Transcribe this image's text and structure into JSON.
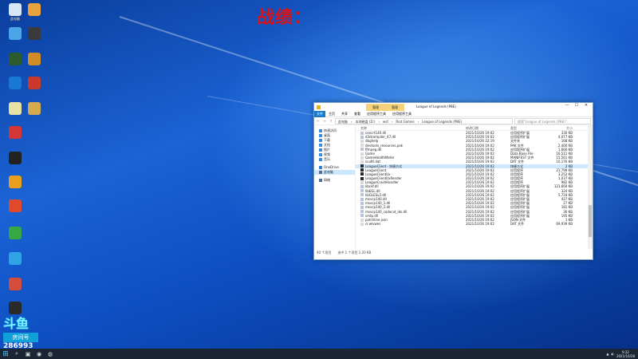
{
  "overlay": {
    "text": "战绩："
  },
  "desktop_icons": [
    {
      "label": "此电脑",
      "color": "#d9e6f5"
    },
    {
      "label": "",
      "color": "#e9a33c"
    },
    {
      "label": "",
      "color": "#4aa6e8"
    },
    {
      "label": "",
      "color": "#3a3a3a"
    },
    {
      "label": "",
      "color": "#2e5b2e"
    },
    {
      "label": "",
      "color": "#d08c25"
    },
    {
      "label": "",
      "color": "#1a78d4"
    },
    {
      "label": "",
      "color": "#c93a2c"
    },
    {
      "label": "",
      "color": "#e7e2a2"
    },
    {
      "label": "",
      "color": "#d5a950"
    },
    {
      "label": "",
      "color": "#d43535"
    },
    {
      "label": "",
      "color": "#222"
    },
    {
      "label": "",
      "color": "#e8a01c"
    },
    {
      "label": "",
      "color": "#e04a2c"
    },
    {
      "label": "",
      "color": "#35a844"
    },
    {
      "label": "",
      "color": "#2ea4e6"
    },
    {
      "label": "",
      "color": "#d44d3c"
    },
    {
      "label": "",
      "color": "#2a2a2a"
    }
  ],
  "badge": {
    "logo": "斗鱼",
    "label": "房间号",
    "number": "286993"
  },
  "window": {
    "title": "League of Legends (PBE)",
    "tool_tab": [
      "管理",
      "管理"
    ],
    "ribbon": [
      "文件",
      "主页",
      "共享",
      "查看",
      "应用程序工具",
      "应用程序工具"
    ],
    "path": [
      "此电脑",
      "本地磁盘 (D:)",
      "wsf",
      "Riot Games",
      "League of Legends (PBE)"
    ],
    "search_placeholder": "搜索\"League of Legends (PBE)\"",
    "nav": [
      "快速访问",
      "桌面",
      "下载",
      "文档",
      "图片",
      "视频",
      "音乐",
      "OneDrive",
      "此电脑",
      "网络"
    ],
    "headers": {
      "name": "名称",
      "date": "修改日期",
      "type": "类型",
      "size": "大小"
    },
    "files": [
      {
        "name": "concrt140.dll",
        "date": "2021/10/26 19:02",
        "type": "应用程序扩展",
        "size": "330 KB",
        "icon": "dll"
      },
      {
        "name": "d3dcompiler_47.dll",
        "date": "2021/10/26 19:02",
        "type": "应用程序扩展",
        "size": "4,077 KB",
        "icon": "dll"
      },
      {
        "name": "dbghelp",
        "date": "2021/10/26 22:19",
        "type": "文件夹",
        "size": "168 KB",
        "icon": "file"
      },
      {
        "name": "devtools_resources.pak",
        "date": "2021/10/26 19:02",
        "type": "PAK 文件",
        "size": "2,400 KB",
        "icon": "file"
      },
      {
        "name": "ffmpeg.dll",
        "date": "2021/10/26 19:02",
        "type": "应用程序扩展",
        "size": "1,666 KB",
        "icon": "dll"
      },
      {
        "name": "Game",
        "date": "2021/10/26 19:02",
        "type": "Data Base File",
        "size": "16,511 KB",
        "icon": "file"
      },
      {
        "name": "GameHealthMeter",
        "date": "2021/10/26 19:02",
        "type": "MANIFEST 文件",
        "size": "15,561 KB",
        "icon": "file"
      },
      {
        "name": "icudtl.dat",
        "date": "2021/10/26 19:02",
        "type": "DAT 文件",
        "size": "10,176 KB",
        "icon": "file"
      },
      {
        "name": "LeagueClient - 快捷方式",
        "date": "2021/10/26 19:02",
        "type": "快捷方式",
        "size": "2 KB",
        "icon": "lol",
        "sel": true
      },
      {
        "name": "LeagueClient",
        "date": "2021/10/26 19:02",
        "type": "应用程序",
        "size": "21,799 KB",
        "icon": "lol"
      },
      {
        "name": "LeagueClientUx",
        "date": "2021/10/26 19:02",
        "type": "应用程序",
        "size": "3,252 KB",
        "icon": "lol"
      },
      {
        "name": "LeagueClientUxRender",
        "date": "2021/10/26 19:02",
        "type": "应用程序",
        "size": "1,037 KB",
        "icon": "lol"
      },
      {
        "name": "LeagueCrashHandler",
        "date": "2021/10/26 19:02",
        "type": "应用程序",
        "size": "982 KB",
        "icon": "file"
      },
      {
        "name": "libcef.dll",
        "date": "2021/10/26 19:02",
        "type": "应用程序扩展",
        "size": "121,660 KB",
        "icon": "dll"
      },
      {
        "name": "libEGL.dll",
        "date": "2021/10/26 19:02",
        "type": "应用程序扩展",
        "size": "324 KB",
        "icon": "dll"
      },
      {
        "name": "libGLESv2.dll",
        "date": "2021/10/26 19:02",
        "type": "应用程序扩展",
        "size": "5,718 KB",
        "icon": "dll"
      },
      {
        "name": "msvcp140.dll",
        "date": "2021/10/26 19:02",
        "type": "应用程序扩展",
        "size": "427 KB",
        "icon": "dll"
      },
      {
        "name": "msvcp140_1.dll",
        "date": "2021/10/26 19:02",
        "type": "应用程序扩展",
        "size": "27 KB",
        "icon": "dll"
      },
      {
        "name": "msvcp140_2.dll",
        "date": "2021/10/26 19:02",
        "type": "应用程序扩展",
        "size": "181 KB",
        "icon": "dll"
      },
      {
        "name": "msvcp140_codecvt_ids.dll",
        "date": "2021/10/26 19:02",
        "type": "应用程序扩展",
        "size": "30 KB",
        "icon": "dll"
      },
      {
        "name": "smtp.dll",
        "date": "2021/10/26 19:02",
        "type": "应用程序扩展",
        "size": "195 KB",
        "icon": "dll"
      },
      {
        "name": "patchline.json",
        "date": "2021/10/26 19:02",
        "type": "JSON 文件",
        "size": "1 KB",
        "icon": "file"
      },
      {
        "name": "cr.wlvwes",
        "date": "2021/10/26 19:02",
        "type": "DAT 文件",
        "size": "69,939 KB",
        "icon": "file"
      }
    ],
    "status": [
      "40 个项目",
      "选中 1 个项目 1.20 KB"
    ]
  },
  "taskbar": {
    "items": [
      "⌕",
      "▣",
      "◉",
      "◍"
    ],
    "time": "9:32",
    "date": "2021/10/28"
  }
}
